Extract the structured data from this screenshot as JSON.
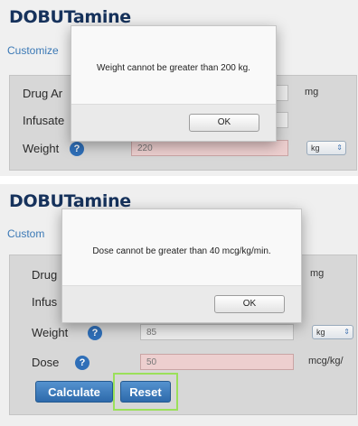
{
  "panel1": {
    "title": "DOBUTamine",
    "subtitle": "Customize",
    "labels": {
      "drug_amount": "Drug Ar",
      "infusate": "Infusate",
      "weight": "Weight"
    },
    "drug_amount_unit": "mg",
    "weight_value": "220",
    "weight_unit_select": "kg",
    "dialog": {
      "message": "Weight cannot be greater than 200 kg.",
      "ok_label": "OK"
    }
  },
  "panel2": {
    "title": "DOBUTamine",
    "subtitle": "Custom",
    "labels": {
      "drug": "Drug",
      "infusate": "Infus",
      "weight": "Weight",
      "dose": "Dose"
    },
    "drug_unit": "mg",
    "weight_value": "85",
    "weight_unit_select": "kg",
    "dose_value": "50",
    "dose_unit": "mcg/kg/",
    "dialog": {
      "message": "Dose cannot be greater than 40 mcg/kg/min.",
      "ok_label": "OK"
    },
    "buttons": {
      "calculate": "Calculate",
      "reset": "Reset"
    }
  },
  "help_glyph": "?",
  "select_arrow_glyph": "⇕",
  "colors": {
    "title": "#16325c",
    "link": "#3a78b5",
    "button": "#2d6aab",
    "error_field": "#edcfcf",
    "highlight": "#9be05a"
  }
}
